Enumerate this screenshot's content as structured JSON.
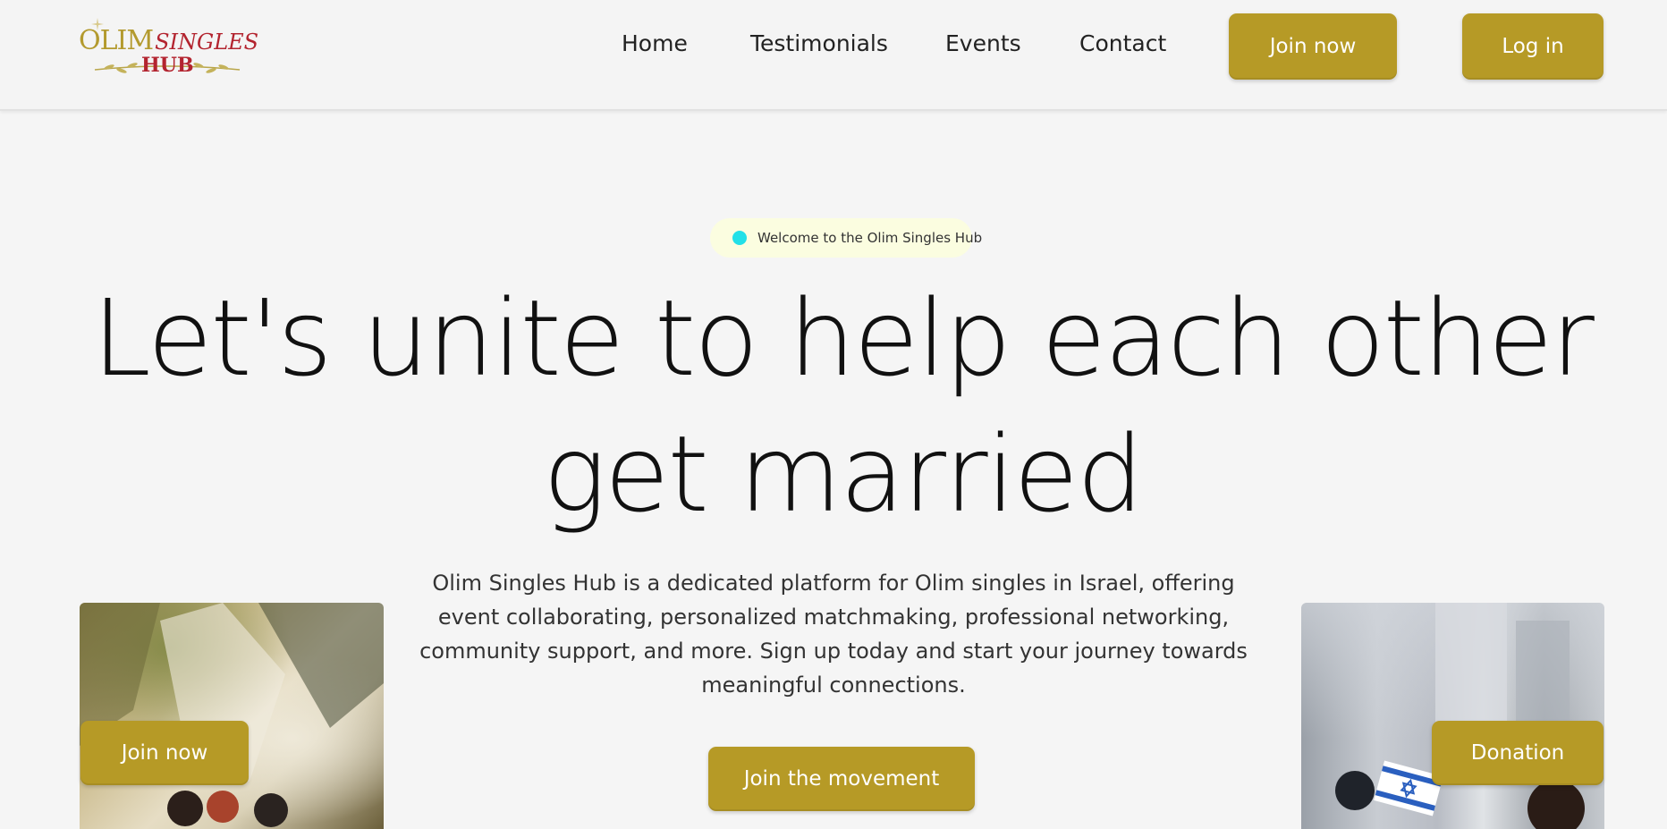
{
  "brand": {
    "logo_olim": "OLIM",
    "logo_singles": "SINGLES",
    "logo_hub": "HUB"
  },
  "nav": {
    "links": [
      "Home",
      "Testimonials",
      "Events",
      "Contact"
    ],
    "join_label": "Join now",
    "login_label": "Log in"
  },
  "hero": {
    "badge_text": "Welcome to the Olim Singles Hub",
    "headline_line1": "Let's unite to help each other",
    "headline_line2": "get married",
    "description": "Olim Singles Hub is a dedicated platform for Olim singles in Israel, offering event collaborating, personalized matchmaking, professional networking, community support, and more. Sign up today and start your journey towards meaningful connections.",
    "cta_label": "Join the movement"
  },
  "photos": {
    "left_button_label": "Join now",
    "right_button_label": "Donation"
  },
  "colors": {
    "accent_gold": "#b69a26",
    "logo_red": "#b3242f",
    "badge_dot": "#22e0e8",
    "badge_bg": "#fbfde0"
  }
}
